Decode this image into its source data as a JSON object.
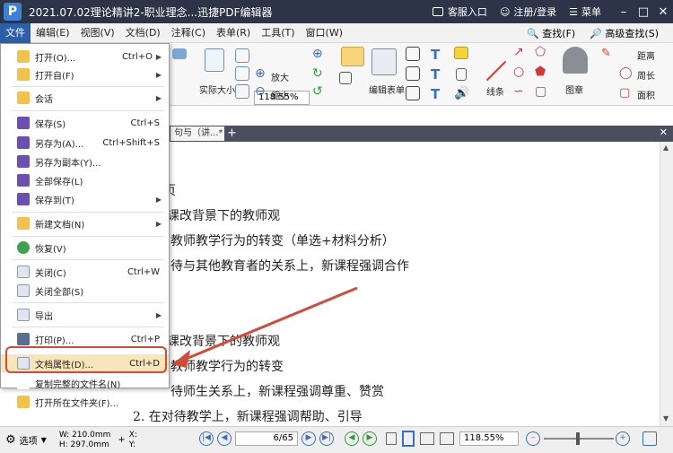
{
  "window": {
    "title": "2021.07.02理论精讲2-职业理念...迅捷PDF编辑器",
    "logo_letter": "P",
    "service": "客服入口",
    "login": "注册/登录",
    "menu": "菜单"
  },
  "menubar": {
    "items": [
      "文件",
      "编辑(E)",
      "视图(V)",
      "文档(D)",
      "注释(C)",
      "表单(R)",
      "工具(T)",
      "窗口(W)"
    ],
    "find": "查找(F)",
    "advanced_find": "高级查找(S)"
  },
  "ribbon": {
    "zoom_value": "118.55%",
    "actual_size": "实际大小",
    "zoom_in": "放大",
    "zoom_out": "缩小",
    "edit_form": "编辑表单",
    "line": "线条",
    "stamp": "图章",
    "distance": "距离",
    "perimeter": "周长",
    "area": "面积"
  },
  "tab": {
    "label": "句与（讲...*",
    "close": "✕"
  },
  "document": {
    "lines": [
      "页",
      "课改背景下的教师观",
      "教师教学行为的转变（单选+材料分析）",
      "待与其他教育者的关系上，新课程强调合作",
      "课改背景下的教师观",
      "教师教学行为的转变",
      "待师生关系上，新课程强调尊重、赞赏",
      "2. 在对待教学上，新课程强调帮助、引导"
    ]
  },
  "file_menu": {
    "items": [
      {
        "label": "打开(O)...",
        "shortcut": "Ctrl+O",
        "submenu": true
      },
      {
        "label": "打开自(F)",
        "shortcut": "",
        "submenu": true
      },
      {
        "label": "会话",
        "shortcut": "",
        "submenu": true
      },
      {
        "label": "保存(S)",
        "shortcut": "Ctrl+S",
        "submenu": false
      },
      {
        "label": "另存为(A)...",
        "shortcut": "Ctrl+Shift+S",
        "submenu": false
      },
      {
        "label": "另存为副本(Y)...",
        "shortcut": "",
        "submenu": false
      },
      {
        "label": "全部保存(L)",
        "shortcut": "",
        "submenu": false
      },
      {
        "label": "保存到(T)",
        "shortcut": "",
        "submenu": true
      },
      {
        "label": "新建文档(N)",
        "shortcut": "",
        "submenu": true
      },
      {
        "label": "恢复(V)",
        "shortcut": "",
        "submenu": false
      },
      {
        "label": "关闭(C)",
        "shortcut": "Ctrl+W",
        "submenu": false
      },
      {
        "label": "关闭全部(S)",
        "shortcut": "",
        "submenu": false
      },
      {
        "label": "导出",
        "shortcut": "",
        "submenu": true
      },
      {
        "label": "打印(P)...",
        "shortcut": "Ctrl+P",
        "submenu": false
      },
      {
        "label": "文档属性(D)...",
        "shortcut": "Ctrl+D",
        "submenu": false
      },
      {
        "label": "复制完整的文件名(N)",
        "shortcut": "",
        "submenu": false
      },
      {
        "label": "打开所在文件夹(F)...",
        "shortcut": "",
        "submenu": false
      }
    ]
  },
  "statusbar": {
    "options": "选项",
    "width": "W: 210.0mm",
    "height": "H: 297.0mm",
    "x": "X:",
    "y": "Y:",
    "page": "6",
    "page_total": "/65",
    "zoom": "118.55%"
  },
  "colors": {
    "titlebar": "#2d3447",
    "menu_active": "#2d5fa8",
    "highlight": "#f7e6b9",
    "annotation_red": "#d24a3a"
  }
}
